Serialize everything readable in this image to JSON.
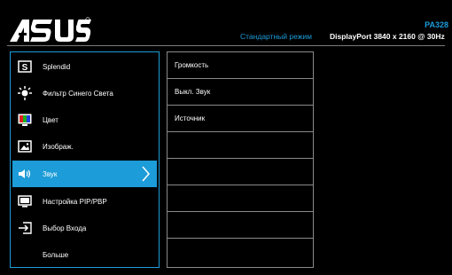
{
  "header": {
    "model": "PA328",
    "mode": "Стандартный режим",
    "input_info": "DisplayPort  3840 x 2160 @ 30Hz"
  },
  "menu": [
    {
      "label": "Splendid",
      "icon": "splendid-icon",
      "active": false
    },
    {
      "label": "Фильтр Синего Света",
      "icon": "blue-light-icon",
      "active": false
    },
    {
      "label": "Цвет",
      "icon": "color-icon",
      "active": false
    },
    {
      "label": "Изображ.",
      "icon": "image-icon",
      "active": false
    },
    {
      "label": "Звук",
      "icon": "speaker-icon",
      "active": true
    },
    {
      "label": "Настройка PIP/PBP",
      "icon": "pip-icon",
      "active": false
    },
    {
      "label": "Выбор Входа",
      "icon": "input-icon",
      "active": false
    },
    {
      "label": "Больше",
      "icon": "",
      "active": false
    }
  ],
  "submenu": [
    {
      "label": "Громкость"
    },
    {
      "label": "Выкл. Звук"
    },
    {
      "label": "Источник"
    },
    {
      "label": ""
    },
    {
      "label": ""
    },
    {
      "label": ""
    },
    {
      "label": ""
    },
    {
      "label": ""
    }
  ],
  "colors": {
    "accent": "#1c9cd8",
    "background": "#000000",
    "border": "#8a8a8a"
  }
}
